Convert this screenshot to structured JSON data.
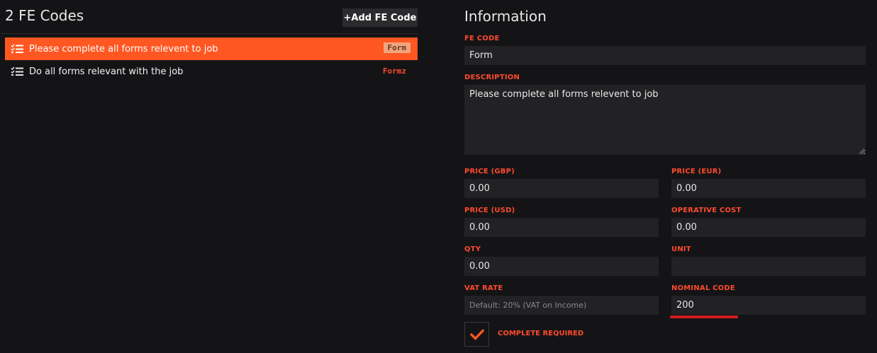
{
  "left_panel": {
    "count_title": "2 FE Codes",
    "add_button_label": "+Add FE Code",
    "items": [
      {
        "label": "Please complete all forms relevent to job",
        "code": "Form",
        "selected": true
      },
      {
        "label": "Do all forms relevant with the job",
        "code": "Formz",
        "selected": false
      }
    ]
  },
  "info_panel": {
    "title": "Information",
    "fe_code": {
      "label": "FE CODE",
      "value": "Form"
    },
    "description": {
      "label": "DESCRIPTION",
      "value": "Please complete all forms relevent to job"
    },
    "price_gbp": {
      "label": "PRICE (GBP)",
      "value": "0.00"
    },
    "price_eur": {
      "label": "PRICE (EUR)",
      "value": "0.00"
    },
    "price_usd": {
      "label": "PRICE (USD)",
      "value": "0.00"
    },
    "operative_cost": {
      "label": "OPERATIVE COST",
      "value": "0.00"
    },
    "qty": {
      "label": "QTY",
      "value": "0.00"
    },
    "unit": {
      "label": "UNIT",
      "value": ""
    },
    "vat_rate": {
      "label": "VAT RATE",
      "placeholder": "Default: 20% (VAT on Income)"
    },
    "nominal_code": {
      "label": "NOMINAL CODE",
      "value": "200"
    },
    "complete_required": {
      "label": "COMPLETE REQUIRED",
      "checked": true
    }
  },
  "colors": {
    "accent": "#ff5722",
    "label_red": "#ff4a2e",
    "background": "#141416",
    "input_bg": "#222225",
    "annotation_red": "#d21e1e"
  },
  "icons": {
    "list_item_icon": "checklist-icon",
    "checkbox_icon": "checkmark-icon"
  }
}
